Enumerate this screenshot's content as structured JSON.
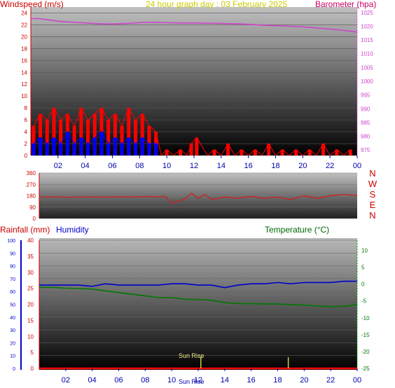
{
  "header": {
    "windspeed_label": "Windspeed (m/s)",
    "graph_title": "24 hour graph day : 03 February 2025",
    "barometer_label": "Barometer (hpa)"
  },
  "compass": [
    "N",
    "W",
    "S",
    "E",
    "N"
  ],
  "lower_labels": {
    "rainfall": "Rainfall (mm)",
    "humidity": "Humidity",
    "temperature": "Temperature (°C)"
  },
  "sun_labels": {
    "sunrise": "Sun Rise",
    "sunset": "Sun Rise"
  },
  "colors": {
    "windspeed": "#ff0000",
    "gust": "#0000ff",
    "barometer": "#cc44cc",
    "direction": "#cc2222",
    "humidity": "#0000cc",
    "temperature": "#007700",
    "rain": "#ff0000",
    "title": "#cccc00",
    "sun": "#cccc44",
    "time_ticks": "#0000aa"
  },
  "chart_data": [
    {
      "type": "line",
      "id": "wind-baro",
      "x_ticks": [
        "02",
        "04",
        "06",
        "08",
        "10",
        "12",
        "14",
        "16",
        "18",
        "20",
        "22",
        "00"
      ],
      "xlim": [
        0,
        24
      ],
      "y_left": {
        "label": "Windspeed (m/s)",
        "ylim": [
          0,
          25
        ],
        "ticks": [
          0,
          2,
          4,
          6,
          8,
          10,
          12,
          14,
          16,
          18,
          20,
          22,
          24
        ]
      },
      "y_right": {
        "label": "Barometer (hpa)",
        "ylim": [
          973,
          1027
        ],
        "ticks": [
          975,
          980,
          985,
          990,
          995,
          1000,
          1005,
          1010,
          1015,
          1020,
          1025
        ]
      },
      "series": [
        {
          "name": "Barometer",
          "axis": "right",
          "x": [
            0,
            0.5,
            1,
            1.5,
            2,
            3,
            4,
            5,
            6,
            7,
            8,
            9,
            10,
            11,
            12,
            13,
            14,
            15,
            16,
            17,
            18,
            19,
            20,
            21,
            22,
            23,
            24
          ],
          "values": [
            1022.8,
            1022.8,
            1022.5,
            1022.2,
            1021.8,
            1021.5,
            1021.2,
            1020.9,
            1020.8,
            1021.0,
            1021.3,
            1021.4,
            1021.3,
            1021.2,
            1021.2,
            1021.1,
            1021.0,
            1020.9,
            1020.7,
            1020.4,
            1020.2,
            1020.0,
            1019.8,
            1019.4,
            1019.0,
            1018.5,
            1017.9
          ]
        },
        {
          "name": "Windspeed",
          "axis": "left",
          "x": [
            0.2,
            0.7,
            1.2,
            1.7,
            2.2,
            2.7,
            3.2,
            3.7,
            4.2,
            4.7,
            5.2,
            5.7,
            6.2,
            6.7,
            7.2,
            7.7,
            8.2,
            8.7,
            9.2,
            9.6,
            10.0,
            10.5,
            11.0,
            11.5,
            11.8,
            12.2,
            13.0,
            13.5,
            14.0,
            14.5,
            15.0,
            15.5,
            16.0,
            16.5,
            17.0,
            17.5,
            18.0,
            18.5,
            19.0,
            19.5,
            20.0,
            20.5,
            21.0,
            21.5,
            22.0,
            22.5,
            23.0,
            23.5
          ],
          "values": [
            5,
            7,
            6,
            8,
            6,
            7,
            5,
            8,
            6,
            7,
            8,
            6,
            7,
            5,
            8,
            6,
            7,
            5,
            4,
            0,
            1,
            0,
            1,
            0,
            2,
            3,
            0,
            1,
            0,
            2,
            0,
            1,
            0,
            1,
            0,
            2,
            0,
            1,
            0,
            1,
            0,
            1,
            0,
            2,
            0,
            1,
            0,
            1
          ]
        },
        {
          "name": "Gust",
          "axis": "left",
          "x": [
            0.2,
            0.7,
            1.2,
            1.7,
            2.2,
            2.7,
            3.2,
            3.7,
            4.2,
            4.7,
            5.2,
            5.7,
            6.2,
            6.7,
            7.2,
            7.7,
            8.2,
            8.7,
            9.2
          ],
          "values": [
            2,
            3,
            2,
            3,
            2,
            4,
            2,
            3,
            2,
            3,
            4,
            2,
            3,
            2,
            3,
            2,
            3,
            2,
            2
          ]
        }
      ]
    },
    {
      "type": "line",
      "id": "wind-direction",
      "xlim": [
        0,
        24
      ],
      "y_left": {
        "ylim": [
          0,
          360
        ],
        "ticks": [
          0,
          90,
          180,
          270,
          360
        ]
      },
      "series": [
        {
          "name": "Direction",
          "x": [
            0,
            1,
            2,
            3,
            4,
            5,
            6,
            7,
            8,
            9,
            9.5,
            10,
            11,
            11.5,
            12,
            12.5,
            13,
            14,
            15,
            16,
            17,
            18,
            19,
            20,
            21,
            22,
            23,
            24
          ],
          "values": [
            170,
            172,
            168,
            170,
            171,
            169,
            172,
            170,
            175,
            170,
            175,
            120,
            155,
            200,
            160,
            190,
            150,
            170,
            160,
            175,
            160,
            170,
            150,
            180,
            160,
            180,
            190,
            180
          ]
        }
      ]
    },
    {
      "type": "line",
      "id": "hum-temp-rain",
      "x_ticks": [
        "02",
        "04",
        "06",
        "08",
        "10",
        "12",
        "14",
        "16",
        "18",
        "20",
        "22",
        "00"
      ],
      "xlim": [
        0,
        24
      ],
      "y_humidity": {
        "label": "Humidity",
        "ylim": [
          0,
          100
        ],
        "ticks": [
          0,
          10,
          20,
          30,
          40,
          50,
          60,
          70,
          80,
          90,
          100
        ]
      },
      "y_rain": {
        "label": "Rainfall (mm)",
        "ylim": [
          0,
          40
        ],
        "ticks": [
          0,
          5,
          10,
          15,
          20,
          25,
          30,
          35,
          40
        ]
      },
      "y_right": {
        "label": "Temperature (°C)",
        "ylim": [
          -25,
          13
        ],
        "ticks": [
          -25,
          -20,
          -15,
          -10,
          -5,
          0,
          5,
          10
        ]
      },
      "sunrise_hour": 12.2,
      "sunset_hour": 18.8,
      "series": [
        {
          "name": "Humidity",
          "axis": "humidity",
          "x": [
            0,
            1,
            2,
            3,
            4,
            5,
            6,
            7,
            8,
            9,
            10,
            11,
            12,
            13,
            14,
            15,
            16,
            17,
            18,
            19,
            20,
            21,
            22,
            23,
            24
          ],
          "values": [
            65,
            65,
            65,
            65,
            64,
            66,
            65,
            65,
            65,
            65,
            66,
            66,
            65,
            65,
            63,
            65,
            66,
            66,
            67,
            66,
            67,
            67,
            67,
            68,
            68
          ]
        },
        {
          "name": "Temperature",
          "axis": "right",
          "x": [
            0,
            1,
            2,
            3,
            4,
            5,
            6,
            7,
            8,
            9,
            10,
            11,
            12,
            13,
            14,
            15,
            16,
            17,
            18,
            19,
            20,
            21,
            22,
            23,
            24
          ],
          "values": [
            -1,
            -1,
            -1.2,
            -1.3,
            -1.5,
            -2.0,
            -2.5,
            -3.0,
            -3.5,
            -4.0,
            -4.0,
            -4.5,
            -4.6,
            -4.8,
            -5.5,
            -5.8,
            -5.8,
            -5.9,
            -5.9,
            -6.1,
            -6.2,
            -6.5,
            -6.7,
            -6.6,
            -6.0
          ]
        },
        {
          "name": "Rainfall",
          "axis": "rain",
          "x": [
            0,
            24
          ],
          "values": [
            0,
            0
          ]
        }
      ]
    }
  ]
}
